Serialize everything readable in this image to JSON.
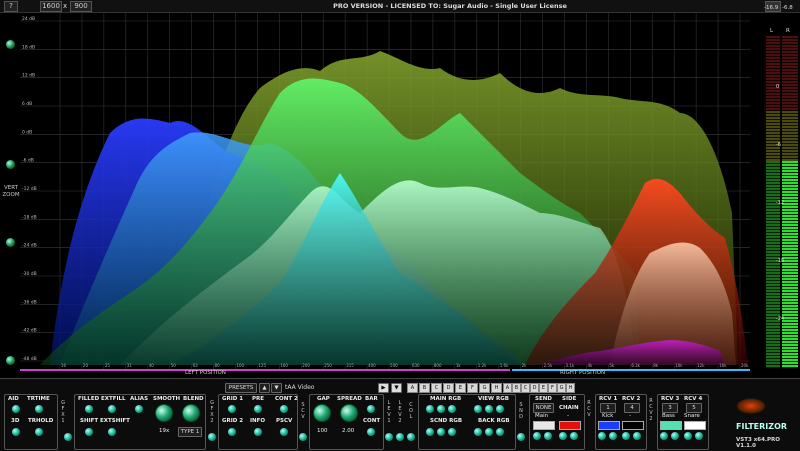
{
  "header": {
    "title": "PRO VERSION - LICENSED TO: Sugar Audio - Single User License",
    "help_label": "?",
    "width_value": "1600",
    "x_label": "x",
    "height_value": "900",
    "top_db": "18.0",
    "meter_peaks": [
      "-16.9",
      "-6.8"
    ],
    "meter_channels": [
      "L",
      "R"
    ]
  },
  "spectrum": {
    "db_labels": [
      "24 dB",
      "18 dB",
      "12 dB",
      "6 dB",
      "0 dB",
      "-6 dB",
      "-12 dB",
      "-18 dB",
      "-24 dB",
      "-30 dB",
      "-36 dB",
      "-42 dB",
      "-48 dB"
    ],
    "freq_labels": [
      "16",
      "20",
      "25",
      "31",
      "40",
      "50",
      "63",
      "80",
      "100",
      "125",
      "160",
      "200",
      "250",
      "315",
      "400",
      "500",
      "630",
      "800",
      "1k",
      "1.2k",
      "1.6k",
      "2k",
      "2.5k",
      "3.1k",
      "4k",
      "5k",
      "6.3k",
      "8k",
      "10k",
      "12k",
      "16k",
      "20k"
    ],
    "vert_zoom_label": "VERT\nZOOM",
    "left_position": "LEFT POSITION",
    "right_position": "RIGHT POSITION"
  },
  "meters": {
    "scale_labels": [
      "0",
      "-6",
      "-12",
      "-18",
      "-24"
    ]
  },
  "presets": {
    "presets_label": "PRESETS",
    "preset_name": "tAA Video",
    "slots": [
      "A",
      "B",
      "C",
      "D",
      "E",
      "F",
      "G",
      "H"
    ],
    "right_slots": [
      "A",
      "B",
      "C",
      "D",
      "E",
      "F",
      "G",
      "H"
    ]
  },
  "controls": {
    "aid": "AID",
    "trtime": "TRTIME",
    "d3": "3D",
    "trhold": "TRHOLD",
    "gfx1": "G\nF\nX\n1",
    "filled": "FILLED",
    "extfill": "EXTFILL",
    "alias": "ALIAS",
    "shift": "SHIFT",
    "extshift": "EXTSHIFT",
    "smooth": "SMOOTH",
    "smooth_value": "19x",
    "blend": "BLEND",
    "blend_value": "TYPE 1",
    "gfx2": "G\nF\nX\n2",
    "grid1": "GRID 1",
    "pre": "PRE",
    "cont2": "CONT 2",
    "grid2": "GRID 2",
    "info": "INFO",
    "pscv": "PSCV",
    "scv": "S\nC\nV",
    "gap": "GAP",
    "gap_value": "100",
    "spread": "SPREAD",
    "spread_value": "2.00",
    "bar": "BAR",
    "cont": "CONT",
    "lev1": "L\nE\nV\n1",
    "lev2": "L\nE\nV\n2",
    "col": "C\nO\nL",
    "main_rgb": "MAIN RGB",
    "view_rgb": "VIEW RGB",
    "scnd_rgb": "SCND RGB",
    "back_rgb": "BACK RGB",
    "snd": "S\nN\nD",
    "send": "SEND",
    "send_value": "NONE",
    "send_main": "Main",
    "side": "SIDE",
    "chain": "CHAIN",
    "rcv_v": "R\nC\nV",
    "rcv1": "RCV 1",
    "rcv1_num": "1",
    "rcv1_name": "Kick",
    "rcv2": "RCV 2",
    "rcv2_num": "4",
    "rcv2_name": "-",
    "rcv2_v": "R\nC\nV\n2",
    "rcv3": "RCV 3",
    "rcv3_num": "3",
    "rcv3_name": "Bass",
    "rcv4": "RCV 4",
    "rcv4_num": "5",
    "rcv4_name": "Snare",
    "version": "VST3 x64.PRO V1.1.0",
    "logo_text": "FILTERIZOR"
  },
  "colors": {
    "rcv1": "#1a3dff",
    "rcv2": "#000000",
    "rcv3": "#55e0b0",
    "rcv4": "#ffffff",
    "chain": "#e01010",
    "send_main": "#e8e8e8"
  }
}
